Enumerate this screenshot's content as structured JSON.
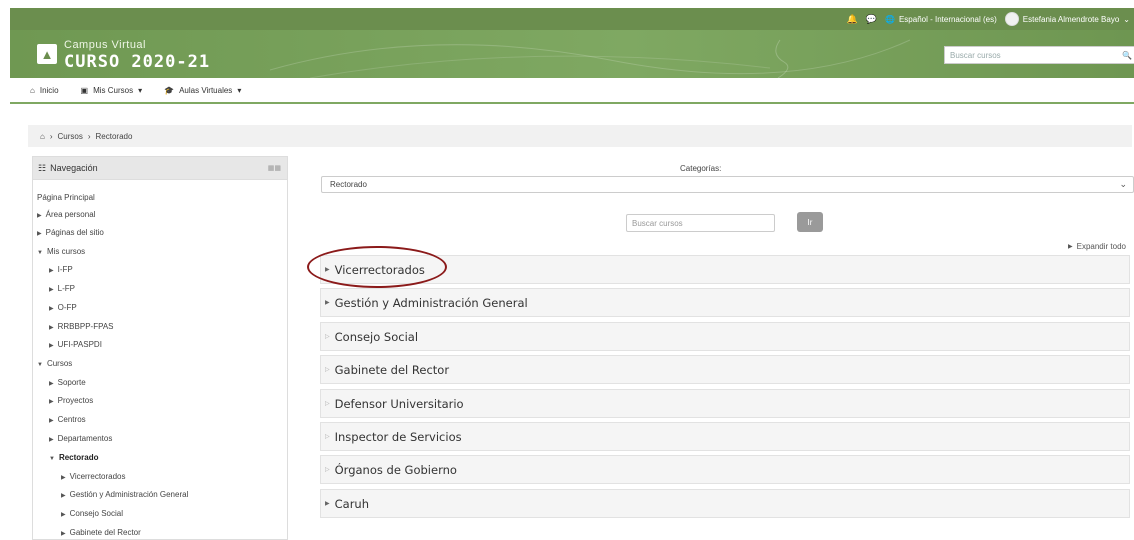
{
  "topbar": {
    "bell_icon": "bell-icon",
    "chat_icon": "chat-icon",
    "language": "Español - Internacional (es)",
    "user_name": "Estefania Almendrote Bayo"
  },
  "banner": {
    "line1": "Campus Virtual",
    "line2": "CURSO 2020-21",
    "search_placeholder": "Buscar cursos"
  },
  "navbar": {
    "items": [
      {
        "label": "Inicio",
        "icon": "home-icon"
      },
      {
        "label": "Mis Cursos",
        "icon": "courses-icon"
      },
      {
        "label": "Aulas Virtuales",
        "icon": "graduation-cap-icon"
      }
    ]
  },
  "breadcrumb": {
    "home_icon": "home-icon",
    "items": [
      "Cursos",
      "Rectorado"
    ]
  },
  "navigation": {
    "title": "Navegación",
    "items": [
      {
        "label": "Página Principal"
      },
      {
        "label": "Área personal"
      },
      {
        "label": "Páginas del sitio"
      },
      {
        "label": "Mis cursos"
      },
      {
        "label": "I-FP"
      },
      {
        "label": "L-FP"
      },
      {
        "label": "O-FP"
      },
      {
        "label": "RRBBPP-FPAS"
      },
      {
        "label": "UFI-PASPDI"
      },
      {
        "label": "Cursos"
      },
      {
        "label": "Soporte"
      },
      {
        "label": "Proyectos"
      },
      {
        "label": "Centros"
      },
      {
        "label": "Departamentos"
      },
      {
        "label": "Rectorado"
      },
      {
        "label": "Vicerrectorados"
      },
      {
        "label": "Gestión y Administración General"
      },
      {
        "label": "Consejo Social"
      },
      {
        "label": "Gabinete del Rector"
      }
    ]
  },
  "main": {
    "categories_label": "Categorías:",
    "category_selected": "Rectorado",
    "search_placeholder": "Buscar cursos",
    "go_button": "Ir",
    "expand_all": "Expandir todo",
    "categories": [
      "Vicerrectorados",
      "Gestión y Administración General",
      "Consejo Social",
      "Gabinete del Rector",
      "Defensor Universitario",
      "Inspector de Servicios",
      "Órganos de Gobierno",
      "Caruh"
    ]
  },
  "colors": {
    "brand": "#6b8e4e",
    "annotation": "#8b1a1a"
  }
}
